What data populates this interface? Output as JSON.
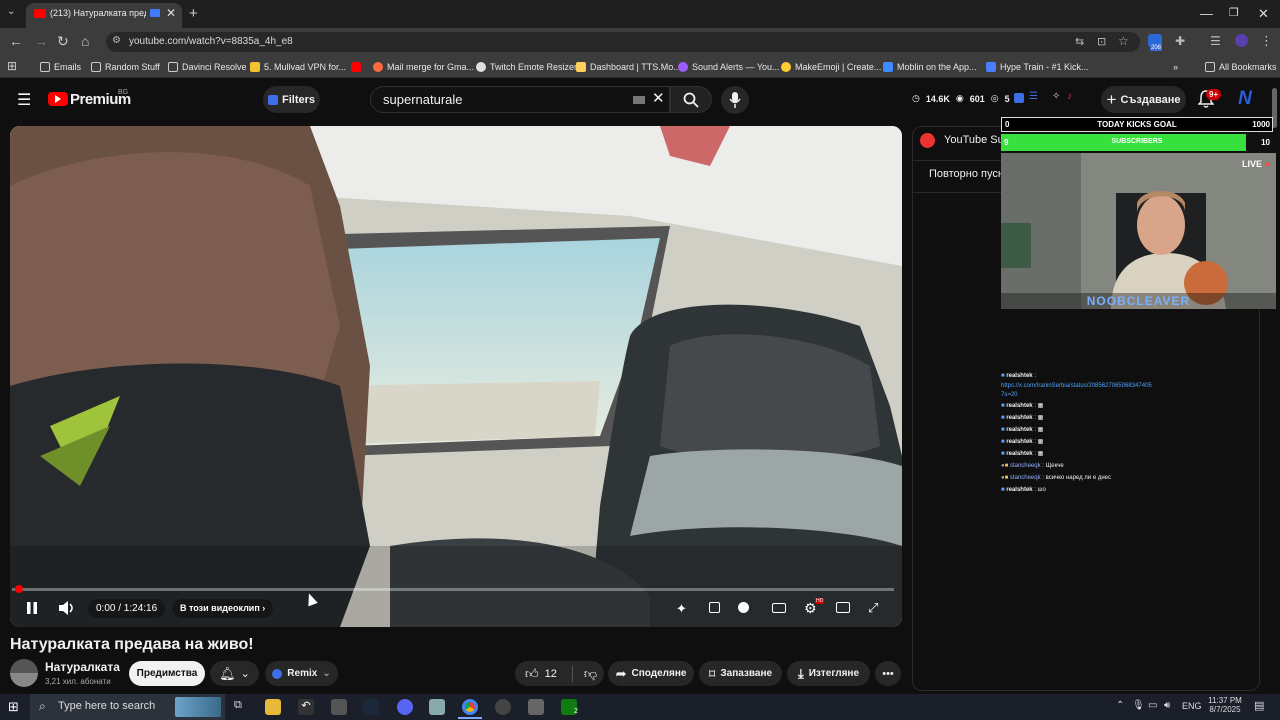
{
  "browser": {
    "tab_title": "(213) Натуралката предава...",
    "url": "youtube.com/watch?v=8835a_4h_e8",
    "ext_badge": "208",
    "bookmarks": [
      {
        "label": "Emails",
        "color": "#cfcfcf"
      },
      {
        "label": "Random Stuff",
        "color": "#cfcfcf"
      },
      {
        "label": "Davinci Resolve",
        "color": "#cfcfcf"
      },
      {
        "label": "5. Mullvad VPN for...",
        "color": "#f2c230"
      },
      {
        "label": "Mail merge for Gma...",
        "color": "#ff6b3d"
      },
      {
        "label": "Twitch Emote Resizer",
        "color": "#e0e0e0"
      },
      {
        "label": "Dashboard | TTS.Mo...",
        "color": "#ffd15c"
      },
      {
        "label": "Sound Alerts — You...",
        "color": "#9c5cff"
      },
      {
        "label": "MakeEmoji | Create...",
        "color": "#ffcc33"
      },
      {
        "label": "Moblin on the App...",
        "color": "#3d8bff"
      },
      {
        "label": "Hype Train - #1 Kick...",
        "color": "#4a7dff"
      }
    ],
    "all_bookmarks": "All Bookmarks"
  },
  "header": {
    "logo_text": "Premium",
    "region": "BG",
    "filters_label": "Filters",
    "search_value": "supernaturale",
    "stats": {
      "viewers": "14.6K",
      "watching": "601",
      "others": "5"
    },
    "create_label": "Създаване",
    "notif_badge": "9+",
    "avatar_letter": "N"
  },
  "player": {
    "time": "0:00 / 1:24:16",
    "chapter_label": "В този видеоклип",
    "progress": 0.0,
    "settings_badge": "HD"
  },
  "video": {
    "title": "Натуралката предава на живо!",
    "channel": "Натуралката",
    "subscribers": "3,21 хил. абонати",
    "perks_label": "Предимства",
    "remix_label": "Remix",
    "likes": "12",
    "share_label": "Споделяне",
    "save_label": "Запазване",
    "download_label": "Изтегляне"
  },
  "side_panel": {
    "title": "YouTube Sur",
    "replay": "Повторно пусн"
  },
  "overlay": {
    "goal_start": "0",
    "goal_label": "TODAY KICKS GOAL",
    "goal_end": "1000",
    "subs_start": "9",
    "subs_label": "SUBSCRIBERS",
    "subs_end": "10",
    "subs_progress": 0.9,
    "live_label": "LIVE",
    "streamer_name": "NOOBCLEAVER",
    "chat": [
      {
        "user": "realshtek",
        "text": ""
      },
      {
        "user": "",
        "text": "https://x.com/IraninSerbia/status/20856270650683474057s=20"
      },
      {
        "user": "realshtek",
        "text": "▦"
      },
      {
        "user": "realshtek",
        "text": "▦"
      },
      {
        "user": "realshtek",
        "text": "▦"
      },
      {
        "user": "realshtek",
        "text": "▦"
      },
      {
        "user": "realshtek",
        "text": "▦"
      },
      {
        "user": "stancheeqk",
        "text": "Щекче"
      },
      {
        "user": "stancheeqk",
        "text": "всичко наред ли е днес"
      },
      {
        "user": "realshtek",
        "text": "шо"
      }
    ]
  },
  "taskbar": {
    "search_placeholder": "Type here to search",
    "lang": "ENG",
    "time": "11:37 PM",
    "date": "8/7/2025",
    "xbox_badge": "2"
  }
}
